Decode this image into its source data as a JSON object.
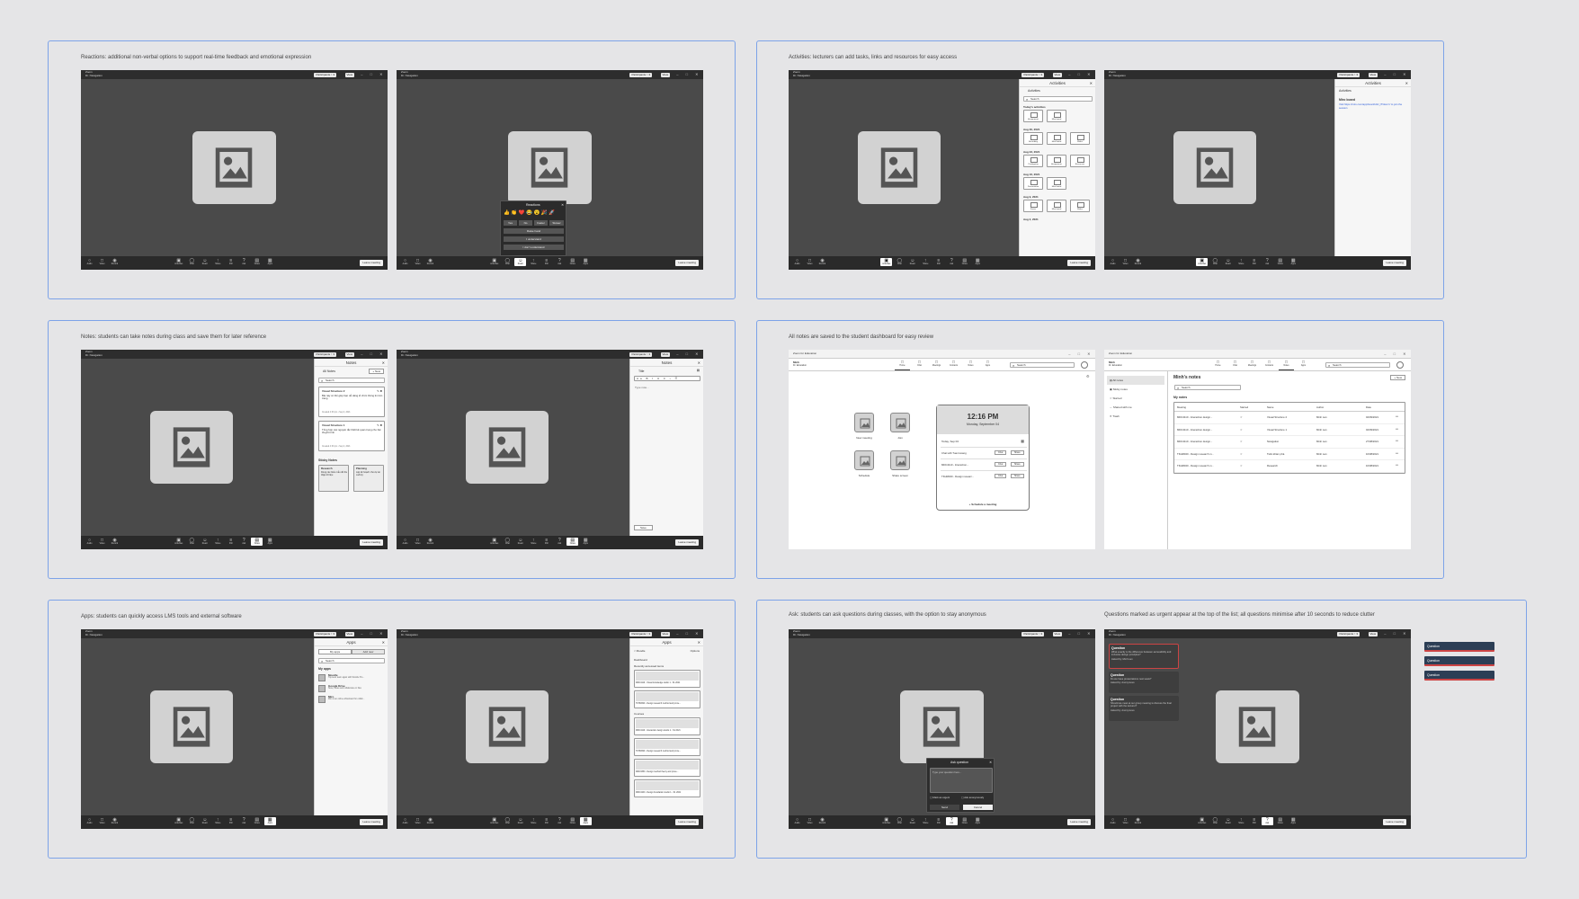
{
  "captions": [
    "Reactions: additional non-verbal options to support real-time feedback and emotional expression",
    "Activities: lecturers can add tasks, links and resources for easy access",
    "Notes: students can take notes during class and save them for later reference",
    "All notes are saved to the student dashboard for easy review",
    "Apps: students can quickly access LMS tools and external software",
    "Ask: students can ask questions during classes, with the option to stay anonymous",
    "Questions marked as urgent appear at the top of the list; all questions minimise after 10 seconds to reduce clutter"
  ],
  "meeting": {
    "title_line1": "Zoom",
    "title_line2": "Dr. Navigation",
    "participants": "Participants ↑ 3",
    "view": "View",
    "window_controls": "– □ ✕",
    "leave": "Leave meeting",
    "left_tools": [
      {
        "label": "Audio",
        "icon": "microphone-icon",
        "glyph": "○"
      },
      {
        "label": "Video",
        "icon": "video-camera-icon",
        "glyph": "□"
      },
      {
        "label": "Record",
        "icon": "record-icon",
        "glyph": "◉"
      }
    ],
    "tools": [
      {
        "label": "Activities",
        "icon": "activities-icon",
        "glyph": "▣"
      },
      {
        "label": "Chat",
        "icon": "chat-icon",
        "glyph": "◯"
      },
      {
        "label": "React",
        "icon": "reaction-icon",
        "glyph": "☺"
      },
      {
        "label": "Share",
        "icon": "share-icon",
        "glyph": "↑"
      },
      {
        "label": "Poll",
        "icon": "poll-icon",
        "glyph": "≡"
      },
      {
        "label": "Ask",
        "icon": "ask-icon",
        "glyph": "?"
      },
      {
        "label": "Notes",
        "icon": "notes-icon",
        "glyph": "▤"
      },
      {
        "label": "Apps",
        "icon": "apps-icon",
        "glyph": "▦"
      }
    ]
  },
  "reactions_popup": {
    "title": "Reactions",
    "emojis": [
      "👍",
      "👏",
      "❤️",
      "😂",
      "😮",
      "🎉",
      "🚀"
    ],
    "buttons": [
      "Yes",
      "No",
      "Faster",
      "Slower"
    ],
    "rows": [
      "Raise hand",
      "I understand",
      "I don't understand"
    ]
  },
  "activities": {
    "title": "Activities",
    "search": "Search",
    "groups": [
      {
        "label": "Today's activities",
        "items": [
          "Assignment",
          "Miro board"
        ]
      },
      {
        "label": "Aug 30, 2021",
        "items": [
          "Recording",
          "Miro board",
          "Slides"
        ]
      },
      {
        "label": "Aug 23, 2021",
        "items": [
          "Prototyping",
          "Assignment",
          "Resources"
        ]
      },
      {
        "label": "Aug 16, 2021",
        "items": [
          "Presentation",
          "Miro board"
        ]
      },
      {
        "label": "Aug 9, 2021",
        "items": [
          "Forms",
          "Miro board",
          "Slides"
        ]
      },
      {
        "label": "Aug 2, 2021",
        "items": []
      }
    ],
    "detail_title": "Miro board",
    "detail_text": "Visit https://miro.com/app/board/o9J_lTGkxc=/ to join the session"
  },
  "notes": {
    "title": "Notes",
    "all_notes": "All Notes",
    "new": "+ New",
    "search": "Search",
    "cards": [
      {
        "title": "Visual Structure 2",
        "body": "Bài này có thể giúp bạn dễ dàng tổ chức thông tin trên trang",
        "date": "Created 4:30 pm • Sep 4, 2021"
      },
      {
        "title": "Visual Structure 1",
        "body": "Tổng hợp các nguyên tắc thiết kế quan trọng cho bài thuyết trình",
        "date": "Created 4:30 pm • Sep 4, 2021"
      }
    ],
    "sticky_label": "Sticky Notes",
    "stickies": [
      {
        "title": "Research",
        "body": "Dùng các biểu mẫu để thu thập dữ liệu"
      },
      {
        "title": "Planning",
        "body": "Lập kế hoạch cho dự án cuối kỳ"
      }
    ],
    "editor_title": "Title",
    "editor_placeholder": "Type note...",
    "save": "Save"
  },
  "dashboard": {
    "app_title": "Zoom for Education",
    "user": "Minh",
    "school": "Dr. Education",
    "nav": [
      "Home",
      "Chat",
      "Meetings",
      "Contacts",
      "Notes",
      "Apps"
    ],
    "search": "Search",
    "tiles": [
      {
        "label": "New meeting",
        "icon": "new-meeting-icon"
      },
      {
        "label": "Join",
        "icon": "join-icon"
      },
      {
        "label": "Schedule",
        "icon": "schedule-icon"
      },
      {
        "label": "Share screen",
        "icon": "share-screen-icon"
      }
    ],
    "clock": "12:16 PM",
    "date": "Monday, September 04",
    "today": "Today, Sep 04",
    "meetings": [
      {
        "name": "Chat with Tuan Hoang",
        "a": "Chat",
        "b": "Share"
      },
      {
        "name": "MDC4110 - Interaction...",
        "a": "Chat",
        "b": "Share"
      },
      {
        "name": "TKHM320 - Design researc...",
        "a": "Chat",
        "b": "Share"
      }
    ],
    "schedule": "+ Schedule a meeting"
  },
  "mynotes": {
    "title": "Minh's notes",
    "new": "+ New",
    "search": "Search",
    "side": [
      "All notes",
      "Sticky notes",
      "Starred",
      "Shared with me",
      "Trash"
    ],
    "section": "My notes",
    "columns": [
      "Meeting",
      "Starred",
      "Name",
      "Author",
      "Date"
    ],
    "rows": [
      [
        "MDC4110 - Interaction design...",
        "☆",
        "Visual Structure 2",
        "Minh Lan",
        "04/09/2021"
      ],
      [
        "MDC4110 - Interaction design...",
        "☆",
        "Visual Structure 1",
        "Minh Lan",
        "04/09/2021"
      ],
      [
        "MDC4110 - Interaction design...",
        "☆",
        "Navigation",
        "Minh Lan",
        "27/08/2021"
      ],
      [
        "TKHM320 - Design research m...",
        "☆",
        "Tuần khám phá",
        "Minh Lan",
        "16/08/2021"
      ],
      [
        "TKHM320 - Design research m...",
        "☆",
        "Research",
        "Minh Lan",
        "16/08/2021"
      ]
    ]
  },
  "apps": {
    "title": "Apps",
    "tabs": [
      "My apps",
      "Add new"
    ],
    "search": "Search",
    "section": "My apps",
    "items": [
      {
        "name": "Moodle",
        "desc": "Top-level learn again with Moodle Pro..."
      },
      {
        "name": "Google Drive",
        "desc": "Store, share and collaborate on files"
      },
      {
        "name": "Miro",
        "desc": "Miro is an online whiteboard for collab..."
      }
    ],
    "moodle_back": "< Moodle",
    "moodle_more": "Options",
    "dashboard": "Dashboard",
    "recent": "Recently accessed items",
    "cards": [
      "MDC4110 - Visual knowledge studio 1 - S1 2021",
      "TKHM320 - Design research method and proce..."
    ],
    "courses_label": "Courses",
    "courses": [
      "MDC4110 - Interaction design studio 1 - S1 2021",
      "TKHM320 - Design research method and proce...",
      "MDC3350 - Design method theory and proce...",
      "MDC4100 - Design foundation studio 1 - S1 2021"
    ]
  },
  "ask": {
    "title": "Ask question",
    "placeholder": "Type your question here...",
    "urgent": "Mark as urgent",
    "anon": "Ask anonymously",
    "send": "Send",
    "cancel": "Cancel",
    "questions": [
      {
        "title": "Question",
        "body": "What exactly is the difference between accessibility and inclusive design principles?",
        "by": "Asked by: Minh Lan"
      },
      {
        "title": "Question",
        "body": "Do we have presentations next week?",
        "by": "Asked by: Anonymous"
      },
      {
        "title": "Question",
        "body": "Should we meet at our group meeting to discuss the final project with the lecturer?",
        "by": "Asked by: Anonymous"
      }
    ],
    "minimized": [
      "Question",
      "Question",
      "Question"
    ]
  }
}
